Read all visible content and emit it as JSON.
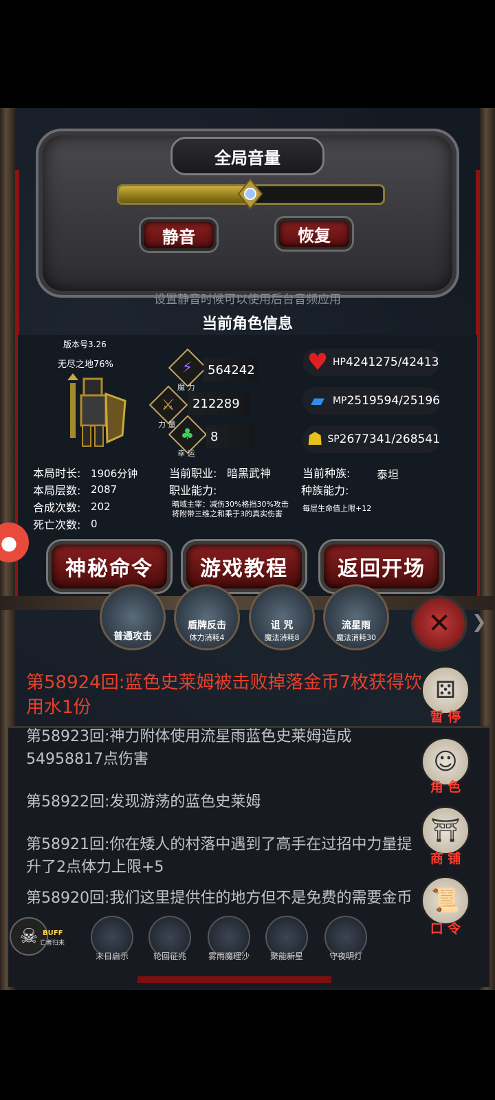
{
  "volume": {
    "title": "全局音量",
    "level": 0.5,
    "mute_label": "静音",
    "restore_label": "恢复",
    "hint": "设置静音时候可以使用后台音频应用"
  },
  "character": {
    "title": "当前角色信息",
    "version": "版本号3.26",
    "area": "无尽之地76%",
    "magic": {
      "label": "魔 力",
      "value": "564242"
    },
    "strength": {
      "label": "力 量",
      "value": "212289"
    },
    "luck": {
      "label": "幸 运",
      "value": "8"
    },
    "hp": {
      "label": "HP",
      "value": "4241275/42413"
    },
    "mp": {
      "label": "MP",
      "value": "2519594/25196"
    },
    "sp": {
      "label": "SP",
      "value": "2677341/268541"
    },
    "stats": [
      {
        "label": "本局时长:",
        "value": "1906分钟"
      },
      {
        "label": "本局层数:",
        "value": "2087"
      },
      {
        "label": "合成次数:",
        "value": "202"
      },
      {
        "label": "死亡次数:",
        "value": "0"
      }
    ],
    "job_label": "当前职业:",
    "job": "暗黑武神",
    "job_ability_label": "职业能力:",
    "job_ability": "暗域主宰：减伤30%格挡30%攻击将附带三维之和乘于3的真实伤害",
    "race_label": "当前种族:",
    "race": "泰坦",
    "race_ability_label": "种族能力:",
    "race_ability": "每层生命值上限+12"
  },
  "actions": {
    "secret": "神秘命令",
    "tutorial": "游戏教程",
    "back": "返回开场"
  },
  "skills": [
    {
      "name": "普通攻击",
      "cost": ""
    },
    {
      "name": "盾牌反击",
      "cost": "体力消耗4"
    },
    {
      "name": "诅 咒",
      "cost": "魔法消耗8"
    },
    {
      "name": "流星雨",
      "cost": "魔法消耗30"
    }
  ],
  "logs": [
    "第58924回:蓝色史莱姆被击败掉落金币7枚获得饮用水1份",
    "第58923回:神力附体使用流星雨蓝色史莱姆造成54958817点伤害",
    "第58922回:发现游荡的蓝色史莱姆",
    "第58921回:你在矮人的村落中遇到了高手在过招中力量提升了2点体力上限+5",
    "第58920回:我们这里提供住的地方但不是免费的需要金币"
  ],
  "side": {
    "pause": "暂 停",
    "role": "角 色",
    "shop": "商 铺",
    "command": "口 令"
  },
  "buff": {
    "label": "BUFF",
    "sub": "亡者归来",
    "items": [
      "末日启示",
      "轮回征兆",
      "雾雨魔理沙",
      "聚能新星",
      "守夜明灯"
    ]
  },
  "colors": {
    "log_highlight": "#e8402a",
    "side_label": "#ff3b30"
  }
}
